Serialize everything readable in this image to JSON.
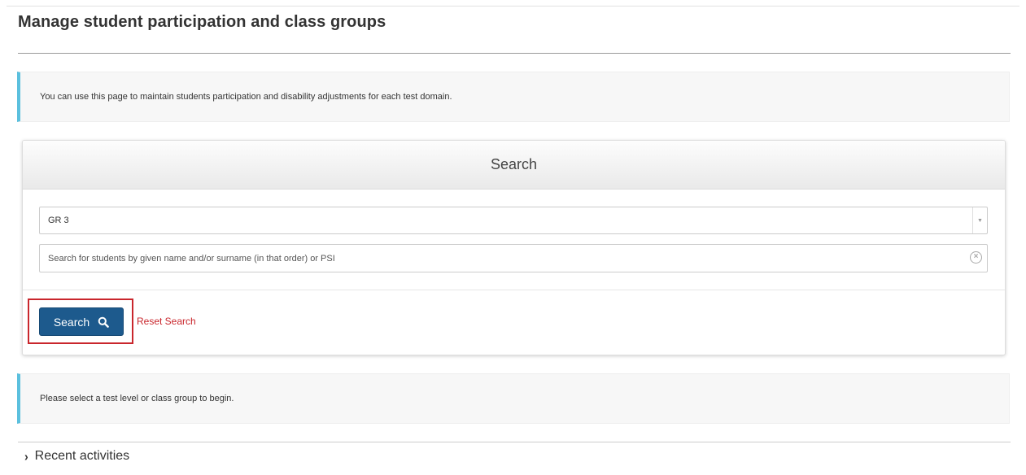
{
  "page": {
    "title": "Manage student participation and class groups"
  },
  "info": {
    "intro": "You can use this page to maintain students participation and disability adjustments for each test domain.",
    "prompt": "Please select a test level or class group to begin."
  },
  "search_panel": {
    "header": "Search",
    "level_select": {
      "selected": "GR 3"
    },
    "student_search": {
      "placeholder": "Search for students by given name and/or surname (in that order) or PSI",
      "value": ""
    },
    "search_button_label": "Search",
    "reset_label": "Reset Search"
  },
  "recent": {
    "label": "Recent activities"
  },
  "icons": {
    "search": "search-icon",
    "clear": "clear-circle-icon",
    "dropdown": "dropdown-arrow-icon",
    "expand": "chevron-right-icon"
  },
  "colors": {
    "primary_button": "#1d5a8d",
    "info_accent": "#5bc0de",
    "reset_link": "#c9262c",
    "highlight": "#c9262c"
  }
}
